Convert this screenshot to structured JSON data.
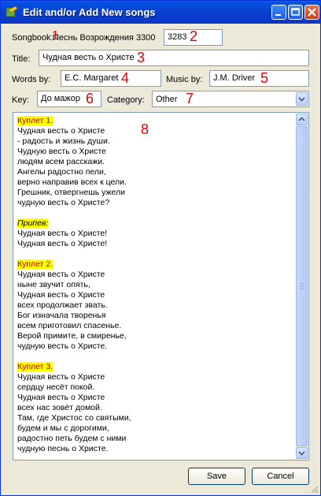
{
  "window": {
    "title": "Edit and/or Add New songs"
  },
  "songbook": {
    "label": "Songbook:",
    "name": "Песнь Возрождения 3300",
    "number": "3283"
  },
  "title_field": {
    "label": "Title:",
    "value": "Чудная весть о Христе"
  },
  "words_field": {
    "label": "Words by:",
    "value": "E.C. Margaret"
  },
  "music_field": {
    "label": "Music by:",
    "value": "J.M. Driver"
  },
  "key_field": {
    "label": "Key:",
    "value": "До мажор"
  },
  "category_field": {
    "label": "Category:",
    "value": "Other"
  },
  "annotations": [
    "1",
    "2",
    "3",
    "4",
    "5",
    "6",
    "7",
    "8"
  ],
  "lyrics": {
    "lines": [
      {
        "text": "Куплет 1.",
        "style": "verse-head"
      },
      {
        "text": "Чудная весть о Христе",
        "style": ""
      },
      {
        "text": "- радость и жизнь души.",
        "style": ""
      },
      {
        "text": "Чудную весть о Христе",
        "style": ""
      },
      {
        "text": "людям всем расскажи.",
        "style": ""
      },
      {
        "text": "Ангелы радостно пели,",
        "style": ""
      },
      {
        "text": "верно направив всех к цели.",
        "style": ""
      },
      {
        "text": "Грешник, отвергнешь ужели",
        "style": ""
      },
      {
        "text": "чудную весть о Христе?",
        "style": ""
      },
      {
        "text": "",
        "style": ""
      },
      {
        "text": "Припев:",
        "style": "chorus-head"
      },
      {
        "text": "Чудная весть о Христе!",
        "style": ""
      },
      {
        "text": "Чудная весть о Христе!",
        "style": ""
      },
      {
        "text": "",
        "style": ""
      },
      {
        "text": "Куплет 2.",
        "style": "verse-head"
      },
      {
        "text": "Чудная весть о Христе",
        "style": ""
      },
      {
        "text": "ныне звучит опять,",
        "style": ""
      },
      {
        "text": "Чудная весть о Христе",
        "style": ""
      },
      {
        "text": "всех продолжает звать.",
        "style": ""
      },
      {
        "text": "Бог изначала творенья",
        "style": ""
      },
      {
        "text": "всем приготовил спасенье.",
        "style": ""
      },
      {
        "text": "Верой примите, в смиренье,",
        "style": ""
      },
      {
        "text": "чудную весть о Христе.",
        "style": ""
      },
      {
        "text": "",
        "style": ""
      },
      {
        "text": "Куплет 3.",
        "style": "verse-head"
      },
      {
        "text": "Чудная весть о Христе",
        "style": ""
      },
      {
        "text": "сердцу несёт покой.",
        "style": ""
      },
      {
        "text": "Чудная весть о Христе",
        "style": ""
      },
      {
        "text": "всех нас зовёт домой.",
        "style": ""
      },
      {
        "text": "Там, где Христос со святыми,",
        "style": ""
      },
      {
        "text": "будем и мы с дорогими,",
        "style": ""
      },
      {
        "text": "радостно петь будем с ними",
        "style": ""
      },
      {
        "text": "чудную песнь о Христе.",
        "style": ""
      }
    ]
  },
  "buttons": {
    "save": "Save",
    "cancel": "Cancel"
  },
  "colors": {
    "titlebar": "#0a3fd0",
    "highlight": "#ffff00",
    "verse_head_text": "#c00000",
    "annotation": "#e00000"
  }
}
